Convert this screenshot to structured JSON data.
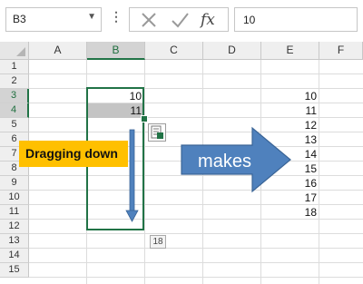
{
  "formula_bar": {
    "name_box": "B3",
    "name_box_dropdown_icon": "chevron-down-icon",
    "menu_icon": "kebab-icon",
    "cancel_icon": "x-icon",
    "enter_icon": "check-icon",
    "function_icon": "fx-icon",
    "function_label": "fx",
    "formula_value": "10"
  },
  "grid": {
    "columns": [
      "A",
      "B",
      "C",
      "D",
      "E",
      "F"
    ],
    "rows": [
      "1",
      "2",
      "3",
      "4",
      "5",
      "6",
      "7",
      "8",
      "9",
      "10",
      "11",
      "12",
      "13",
      "14",
      "15"
    ],
    "selected_column": "B",
    "selected_rows": [
      "3",
      "4"
    ]
  },
  "cells": {
    "B3": "10",
    "B4": "11",
    "E_values": [
      "10",
      "11",
      "12",
      "13",
      "14",
      "15",
      "16",
      "17",
      "18"
    ]
  },
  "autofill": {
    "options_icon": "auto-fill-options-icon",
    "tooltip": "18"
  },
  "annotations": {
    "callout_label": "Dragging down",
    "arrow_label": "makes"
  },
  "colors": {
    "selection": "#217346",
    "callout": "#ffc000",
    "arrow_fill": "#4f81bd"
  }
}
